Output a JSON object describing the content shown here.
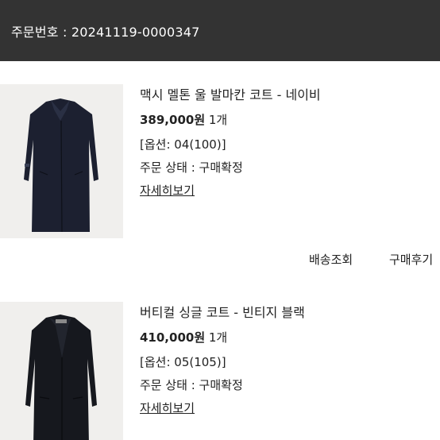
{
  "order": {
    "number_text": "주문번호 : 20241119-0000347"
  },
  "items": [
    {
      "title": "맥시 멜톤 울 발마칸 코트 - 네이비",
      "price": "389,000원",
      "quantity": " 1개",
      "option": "[옵션: 04(100)]",
      "status": "주문 상태 : 구매확정",
      "detail_link": "자세히보기",
      "image_icon": "navy-coat-image"
    },
    {
      "title": "버티컬 싱글 코트 - 빈티지 블랙",
      "price": "410,000원",
      "quantity": " 1개",
      "option": "[옵션: 05(105)]",
      "status": "주문 상태 : 구매확정",
      "detail_link": "자세히보기",
      "image_icon": "black-coat-image"
    }
  ],
  "actions": {
    "track_label": "배송조회",
    "review_label": "구매후기"
  },
  "colors": {
    "header_bg": "#333333",
    "coat_navy": "#1c2030",
    "coat_black": "#16181e",
    "thumb_bg": "#f0efed"
  }
}
